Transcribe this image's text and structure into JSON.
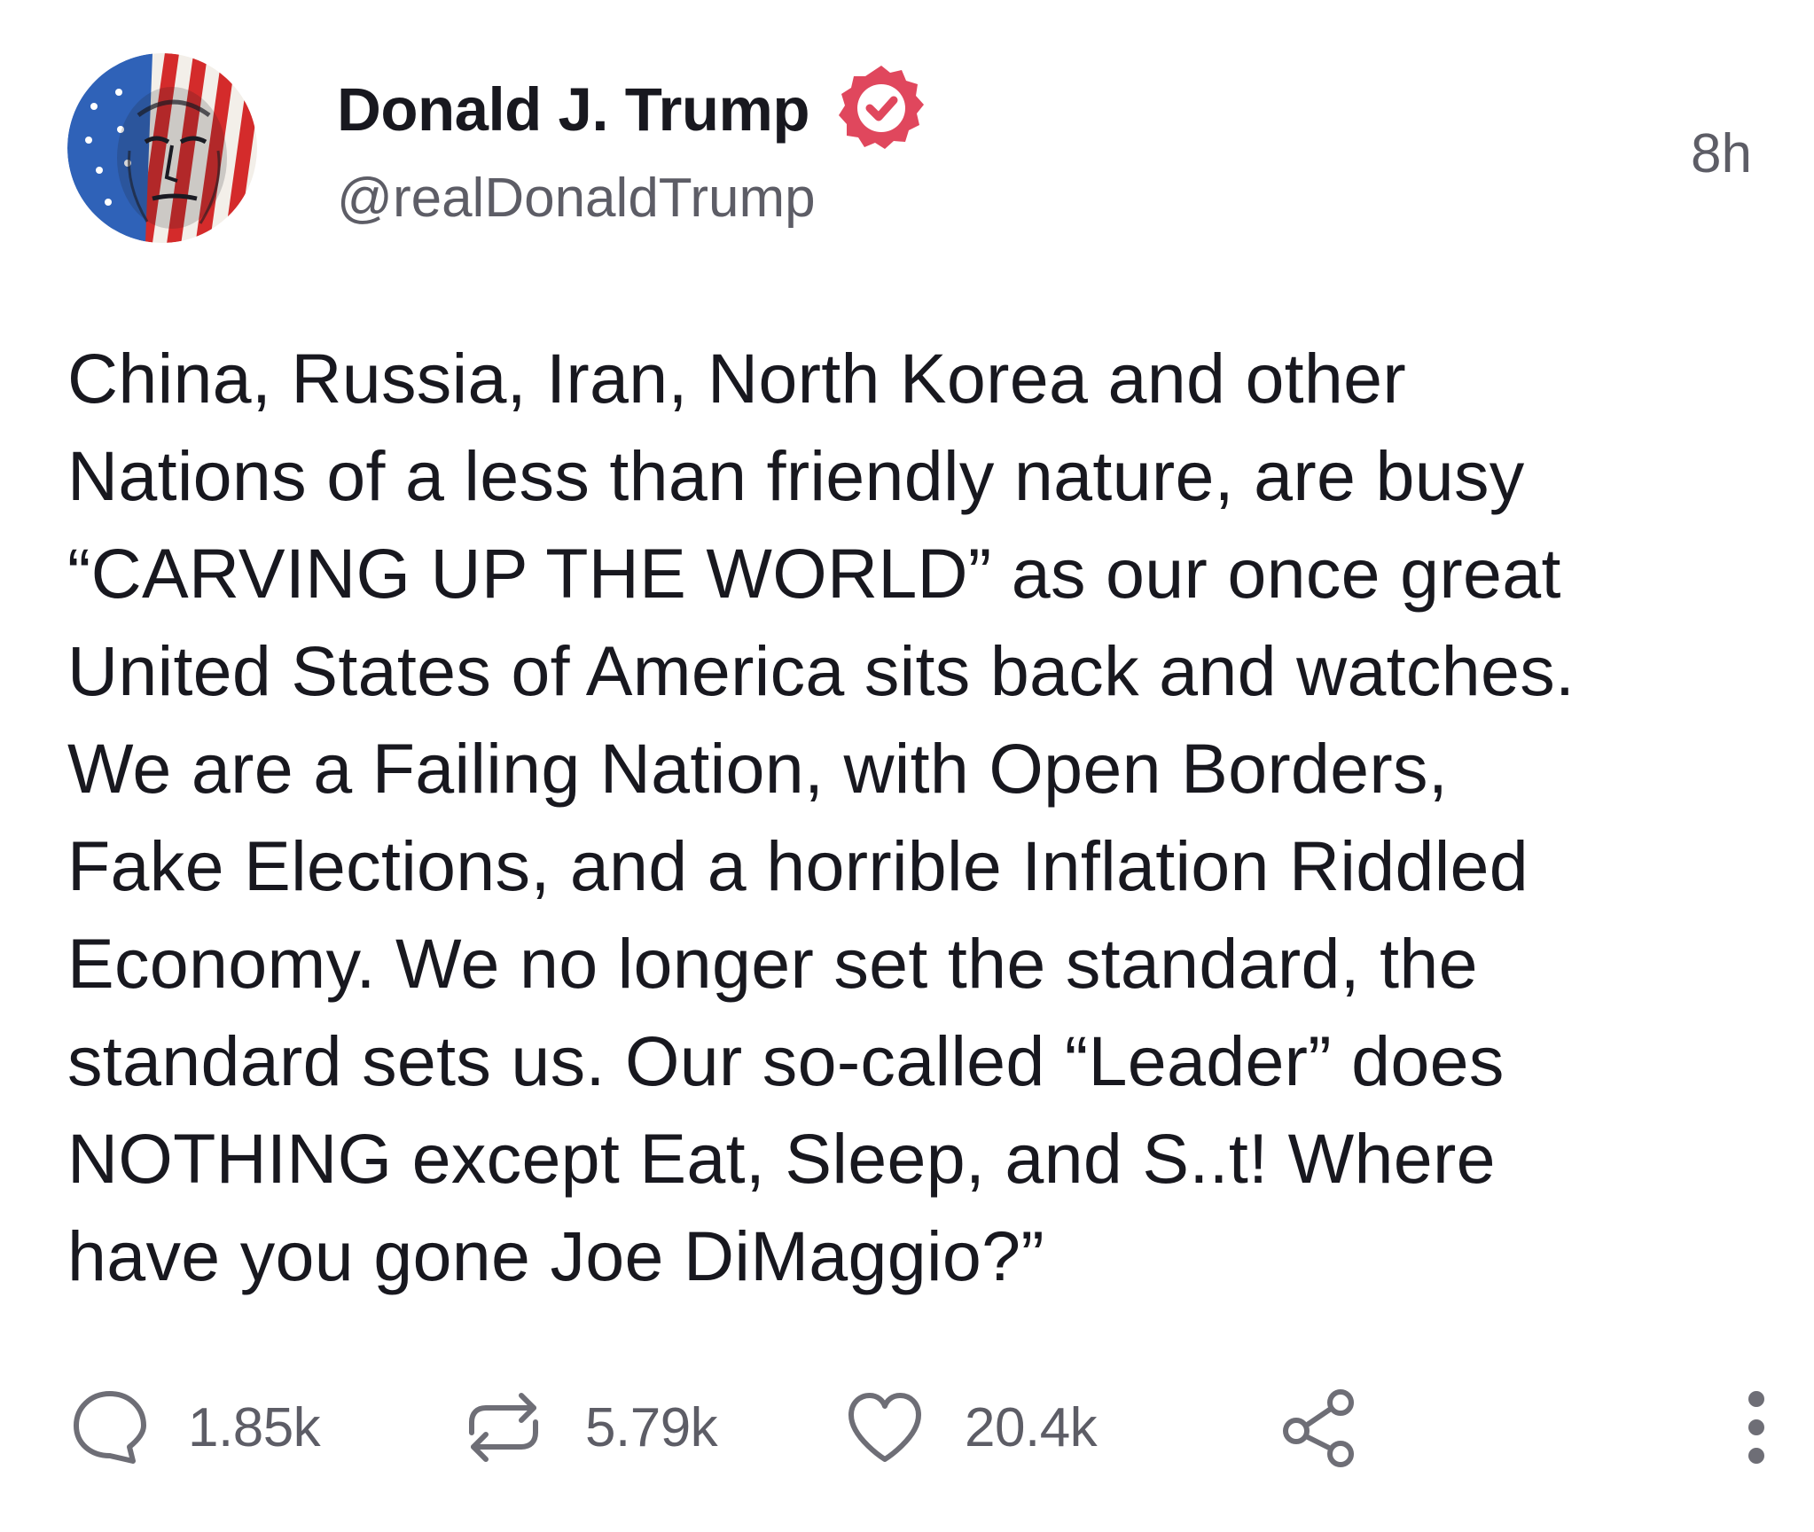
{
  "post": {
    "author": {
      "display_name": "Donald J. Trump",
      "handle": "@realDonaldTrump",
      "verified": true,
      "badge_color": "#e0475d"
    },
    "timestamp": "8h",
    "text_lines": [
      "China, Russia, Iran, North Korea and other",
      "Nations of a less than friendly nature, are busy",
      "“CARVING UP THE WORLD” as our once great",
      "United States of America sits back and watches.",
      "We are a Failing Nation, with Open Borders,",
      "Fake Elections, and a horrible Inflation Riddled",
      "Economy. We no longer set the standard, the",
      "standard sets us. Our so-called “Leader” does",
      "NOTHING except Eat, Sleep, and S..t! Where",
      "have you gone Joe DiMaggio?”"
    ],
    "actions": {
      "replies": "1.85k",
      "reposts": "5.79k",
      "likes": "20.4k"
    }
  },
  "icons": {
    "reply": "speech-bubble-icon",
    "repost": "repost-arrows-icon",
    "like": "heart-icon",
    "share": "share-nodes-icon",
    "more": "vertical-ellipsis-icon",
    "verified": "verified-badge-icon"
  },
  "colors": {
    "text_primary": "#18181f",
    "text_secondary": "#5d5d66",
    "icon_gray": "#6e6e76",
    "verified_red": "#e0475d"
  }
}
